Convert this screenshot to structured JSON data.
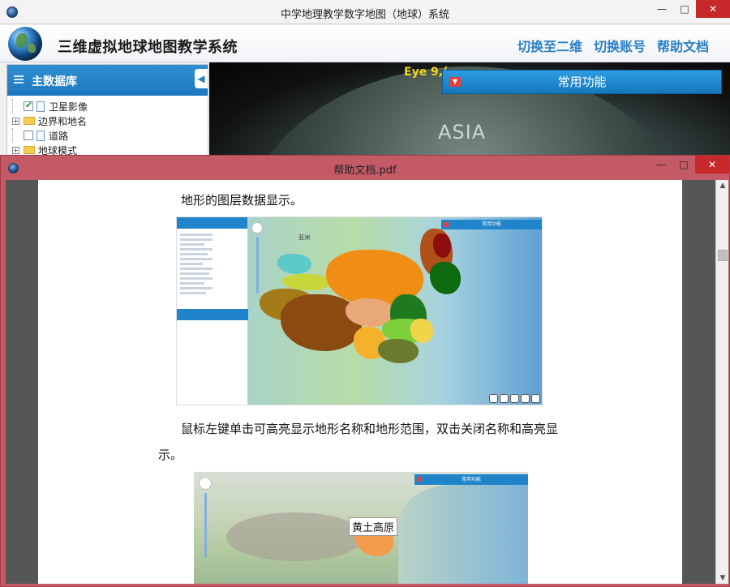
{
  "main_window": {
    "title": "中学地理教学数字地图（地球）系统",
    "controls": {
      "minimize": "—",
      "maximize": "□",
      "close": "✕"
    }
  },
  "header": {
    "app_title": "三维虚拟地球地图教学系统",
    "nav": [
      "切换至二维",
      "切换账号",
      "帮助文档"
    ]
  },
  "left_panel": {
    "title": "主数据库",
    "collapse_glyph": "◀",
    "tree": [
      {
        "label": "卫星影像",
        "type": "layer",
        "checked": true
      },
      {
        "label": "边界和地名",
        "type": "folder",
        "expanded": false
      },
      {
        "label": "道路",
        "type": "layer",
        "checked": false
      },
      {
        "label": "地球模式",
        "type": "folder",
        "expanded": false
      }
    ]
  },
  "globe": {
    "eye_text": "Eye 9,(",
    "asia_label": "ASIA",
    "common_functions": "常用功能"
  },
  "pdf_window": {
    "title": "帮助文档.pdf",
    "controls": {
      "minimize": "—",
      "maximize": "□",
      "close": "✕"
    },
    "paragraph1": "地形的图层数据显示。",
    "paragraph2_line1": "鼠标左键单击可高亮显示地形名称和地形范围，双击关闭名称和高亮显",
    "paragraph2_line2": "示。",
    "figure1": {
      "asia_label": "亚洲",
      "bar_label": "常用功能"
    },
    "figure2": {
      "highlight_label": "黄土高原",
      "bar_label": "常用功能"
    }
  },
  "colors": {
    "accent_blue": "#1f84c9",
    "nav_link": "#2a7fc5",
    "pdf_frame": "#c35a66",
    "close_red": "#c7282a"
  }
}
